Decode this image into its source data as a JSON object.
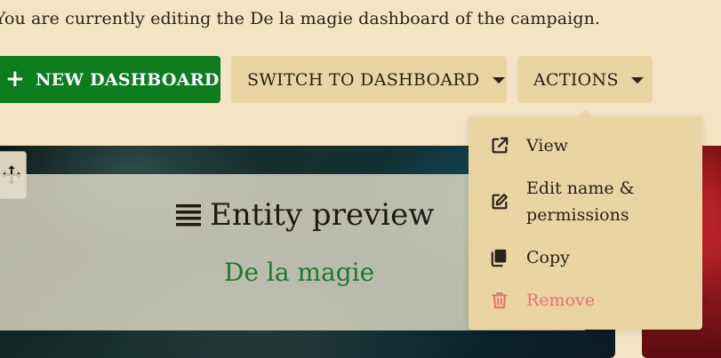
{
  "intro": {
    "text": "You are currently editing the De la magie dashboard of the campaign."
  },
  "toolbar": {
    "new_dashboard": "NEW DASHBOARD",
    "switch_dashboard": "SWITCH TO DASHBOARD",
    "actions": "ACTIONS"
  },
  "widget": {
    "title": "Entity preview",
    "entity_name": "De la magie"
  },
  "actions_menu": {
    "items": [
      {
        "label": "View",
        "icon": "external-link-icon"
      },
      {
        "label": "Edit name & permissions",
        "icon": "edit-icon"
      },
      {
        "label": "Copy",
        "icon": "copy-icon"
      },
      {
        "label": "Remove",
        "icon": "trash-icon"
      }
    ]
  },
  "colors": {
    "page_background": "#f4e4c4",
    "primary_button": "#0e7d1e",
    "secondary_button": "#e9d4a2",
    "link_green": "#1c7a2a",
    "danger": "#e4736e"
  }
}
